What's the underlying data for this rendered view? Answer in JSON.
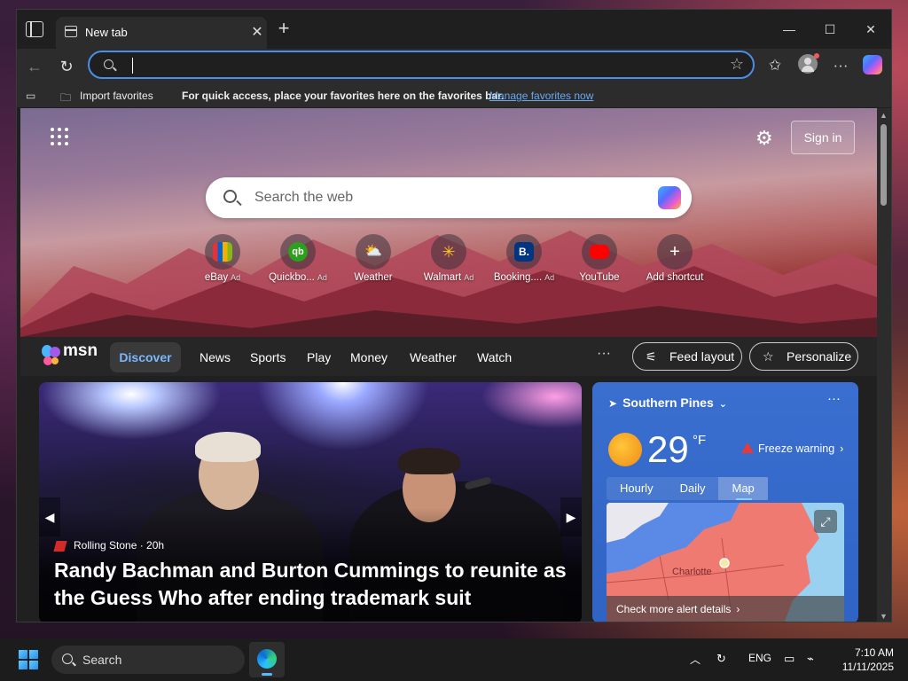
{
  "browser": {
    "tab_title": "New tab",
    "address_value": "",
    "favbar": {
      "import_label": "Import favorites",
      "prompt": "For quick access, place your favorites here on the favorites bar.",
      "manage_link": "Manage favorites now"
    }
  },
  "newtab": {
    "signin_label": "Sign in",
    "search_placeholder": "Search the web",
    "shortcuts": [
      {
        "label": "eBay",
        "ad": "Ad",
        "icon": "ebay-icon",
        "color": "#e53238"
      },
      {
        "label": "Quickbo...",
        "ad": "Ad",
        "icon": "quickbooks-icon",
        "color": "#2ca01c"
      },
      {
        "label": "Weather",
        "ad": "",
        "icon": "weather-icon",
        "color": "#f5b642"
      },
      {
        "label": "Walmart",
        "ad": "Ad",
        "icon": "walmart-icon",
        "color": "#0071dc"
      },
      {
        "label": "Booking....",
        "ad": "Ad",
        "icon": "booking-icon",
        "color": "#003580"
      },
      {
        "label": "YouTube",
        "ad": "",
        "icon": "youtube-icon",
        "color": "#ff0000"
      },
      {
        "label": "Add shortcut",
        "ad": "",
        "icon": "plus-icon",
        "color": "#ffffff"
      }
    ]
  },
  "msn": {
    "brand": "msn",
    "nav": [
      "Discover",
      "News",
      "Sports",
      "Play",
      "Money",
      "Weather",
      "Watch"
    ],
    "more": "···",
    "feed_layout": "Feed layout",
    "personalize": "Personalize"
  },
  "news": {
    "source": "Rolling Stone",
    "age": "20h",
    "source_line": "Rolling Stone · 20h",
    "headline": "Randy Bachman and Burton Cummings to reunite as the Guess Who after ending trademark suit"
  },
  "weather": {
    "location": "Southern Pines",
    "temperature": "29",
    "unit": "°F",
    "alert": "Freeze warning",
    "tabs": [
      "Hourly",
      "Daily",
      "Map"
    ],
    "active_tab": "Map",
    "map_city": "Charlotte",
    "alert_link": "Check more alert details"
  },
  "taskbar": {
    "search_label": "Search",
    "language": "ENG",
    "time": "7:10 AM",
    "date": "11/11/2025"
  }
}
